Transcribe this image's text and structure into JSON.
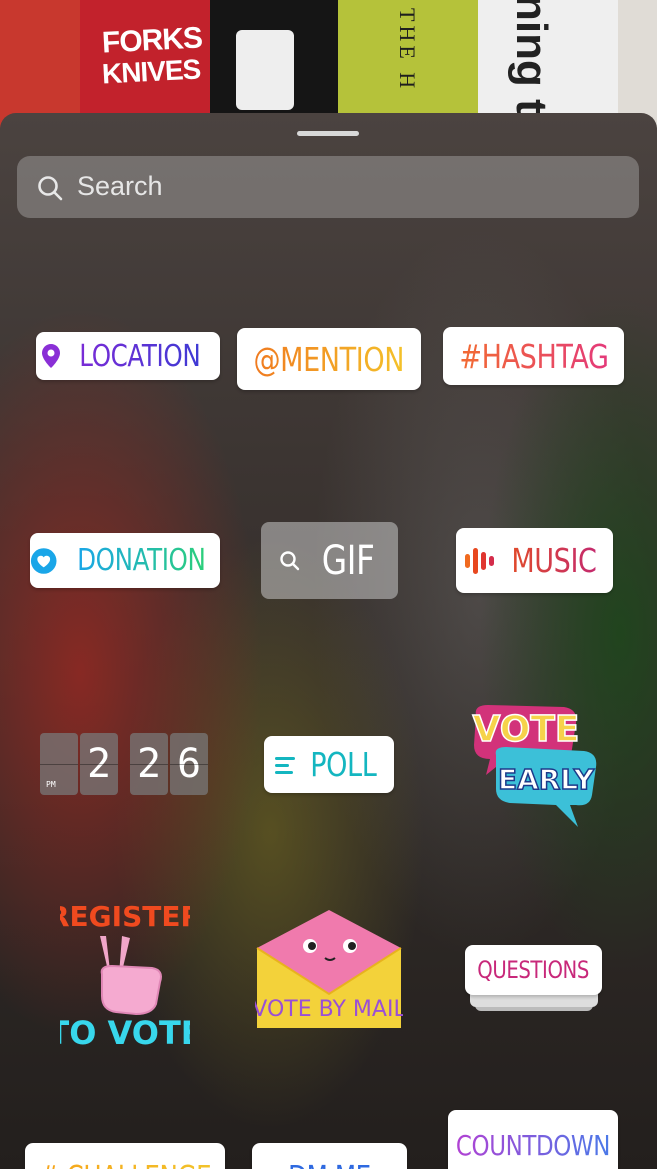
{
  "background": {
    "book_title_1": "FORKS",
    "book_title_2": "KNIVES",
    "book_spine_green": "THE H",
    "book_spine_white": "ning t"
  },
  "search": {
    "placeholder": "Search"
  },
  "stickers": {
    "location": "LOCATION",
    "mention": "@MENTION",
    "hashtag": "#HASHTAG",
    "donation": "DONATION",
    "gif": "GIF",
    "music": "MUSIC",
    "clock": {
      "d1": "2",
      "d2": "2",
      "d3": "6",
      "period": "PM"
    },
    "poll": "POLL",
    "vote_early_line1": "VOTE",
    "vote_early_line2": "EARLY",
    "register_line1": "REGISTER",
    "register_line2": "TO VOTE",
    "vote_by_mail": "VOTE BY MAIL",
    "questions": "QUESTIONS",
    "challenge": "# CHALLENGE",
    "dm_me": "DM ME",
    "countdown": "COUNTDOWN"
  },
  "colors": {
    "location": "#5b33d6",
    "mention": "#f39a24",
    "hashtag": "#ea4f5a",
    "donation": "#1fb8bf",
    "music": "#d4394c",
    "poll": "#14b6c0",
    "questions": "#c8287a",
    "countdown": "#7a5ee0"
  }
}
